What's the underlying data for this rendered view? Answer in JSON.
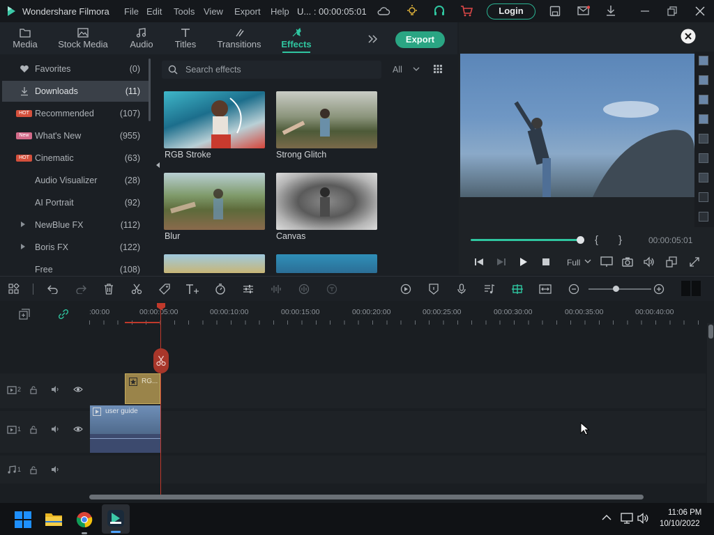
{
  "app": {
    "name": "Wondershare Filmora",
    "project": "U... : 00:00:05:01"
  },
  "menu": [
    "File",
    "Edit",
    "Tools",
    "View",
    "Export",
    "Help"
  ],
  "login_label": "Login",
  "tabs": [
    {
      "label": "Media",
      "icon": "folder-icon"
    },
    {
      "label": "Stock Media",
      "icon": "image-icon"
    },
    {
      "label": "Audio",
      "icon": "music-note-icon"
    },
    {
      "label": "Titles",
      "icon": "text-icon"
    },
    {
      "label": "Transitions",
      "icon": "transitions-icon"
    },
    {
      "label": "Effects",
      "icon": "effects-icon",
      "active": true
    }
  ],
  "export_label": "Export",
  "sidebar": [
    {
      "label": "Favorites",
      "count": "(0)",
      "icon": "heart-icon"
    },
    {
      "label": "Downloads",
      "count": "(11)",
      "icon": "download-icon",
      "selected": true
    },
    {
      "label": "Recommended",
      "count": "(107)",
      "badge": "HOT"
    },
    {
      "label": "What's New",
      "count": "(955)",
      "badge": "New"
    },
    {
      "label": "Cinematic",
      "count": "(63)",
      "badge": "HOT"
    },
    {
      "label": "Audio Visualizer",
      "count": "(28)"
    },
    {
      "label": "AI Portrait",
      "count": "(92)"
    },
    {
      "label": "NewBlue FX",
      "count": "(112)",
      "expandable": true
    },
    {
      "label": "Boris FX",
      "count": "(122)",
      "expandable": true
    },
    {
      "label": "Free",
      "count": "(108)"
    }
  ],
  "search": {
    "placeholder": "Search effects",
    "filter": "All"
  },
  "effects": [
    {
      "label": "RGB Stroke"
    },
    {
      "label": "Strong Glitch"
    },
    {
      "label": "Blur"
    },
    {
      "label": "Canvas"
    }
  ],
  "preview": {
    "timecode": "00:00:05:01",
    "quality": "Full",
    "braces_open": "{",
    "braces_close": "}",
    "progress": 1.0
  },
  "timeline": {
    "ticks": [
      ":00:00",
      "00:00:05:00",
      "00:00:10:00",
      "00:00:15:00",
      "00:00:20:00",
      "00:00:25:00",
      "00:00:30:00",
      "00:00:35:00",
      "00:00:40:00"
    ],
    "tracks": [
      {
        "num": "2",
        "type": "video"
      },
      {
        "num": "1",
        "type": "video"
      },
      {
        "num": "1",
        "type": "audio"
      }
    ],
    "clips": {
      "effect": "RG...",
      "video": "user guide"
    }
  },
  "taskbar": {
    "time": "11:06 PM",
    "date": "10/10/2022"
  },
  "colors": {
    "accent": "#2fc6a0",
    "playhead": "#c0392b",
    "effect_clip": "#b4974f",
    "video_clip": "#3c4a6e"
  }
}
